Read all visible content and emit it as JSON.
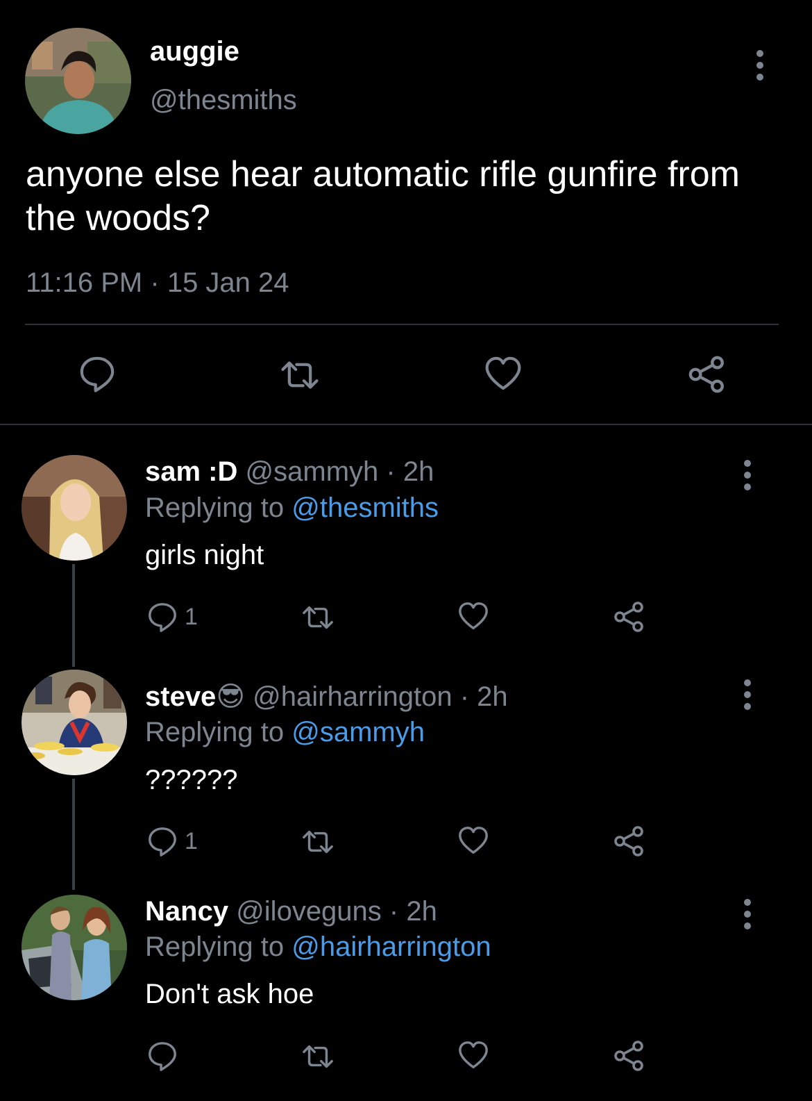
{
  "main_tweet": {
    "name": "auggie",
    "handle": "@thesmiths",
    "text": "anyone else hear automatic rifle gunfire from the woods?",
    "time": "11:16 PM",
    "separator": "·",
    "date": "15 Jan 24"
  },
  "replies": [
    {
      "name": "sam :D",
      "handle": "@sammyh",
      "time_sep": "·",
      "time": "2h",
      "replying_prefix": "Replying to ",
      "replying_to": "@thesmiths",
      "text": "girls night",
      "reply_count": "1"
    },
    {
      "name": "steve",
      "emoji": "😎",
      "handle": "@hairharrington",
      "time_sep": "·",
      "time": "2h",
      "replying_prefix": "Replying to ",
      "replying_to": "@sammyh",
      "text": "??????",
      "reply_count": "1"
    },
    {
      "name": "Nancy",
      "handle": "@iloveguns",
      "time_sep": "·",
      "time": "2h",
      "replying_prefix": "Replying to ",
      "replying_to": "@hairharrington",
      "text": "Don't ask hoe",
      "reply_count": ""
    }
  ],
  "colors": {
    "background": "#000000",
    "secondary_text": "#7d8690",
    "link": "#4a9be8",
    "divider": "#2f3336"
  },
  "icons": [
    "more-icon",
    "reply-icon",
    "retweet-icon",
    "like-icon",
    "share-icon"
  ]
}
